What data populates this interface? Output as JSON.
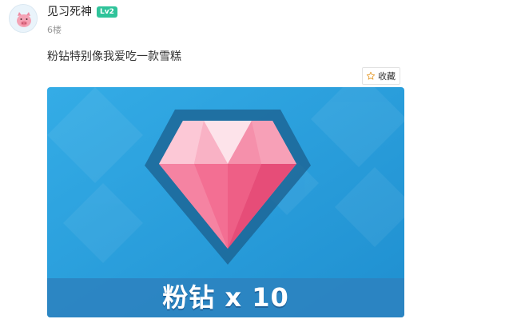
{
  "post": {
    "author": {
      "name": "见习死神",
      "level": "Lv2",
      "avatar_icon": "pig-avatar-icon"
    },
    "floor": "6楼",
    "text": "粉钻特别像我爱吃一款雪糕",
    "favorite_button": {
      "label": "收藏",
      "icon": "star-icon"
    },
    "image": {
      "caption": "粉钻 x 10",
      "subject": "pink-diamond-icon",
      "colors": {
        "background": "#2a9fdb",
        "diamond": "#f47b9c",
        "caption_band": "#2c83c0"
      }
    }
  }
}
